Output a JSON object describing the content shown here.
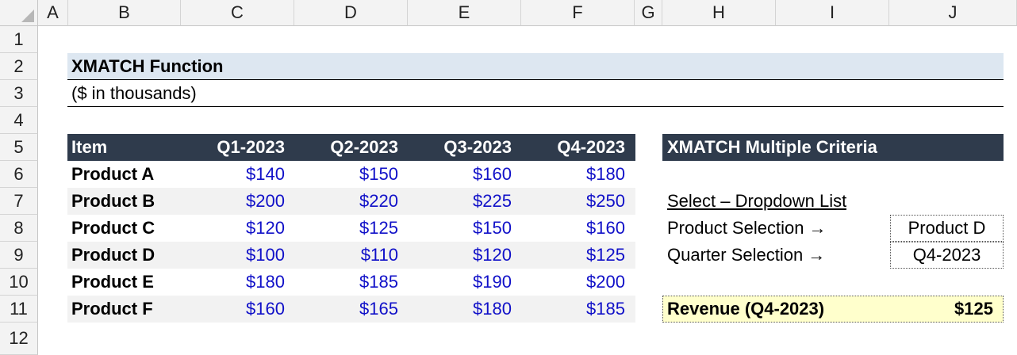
{
  "columns": [
    "A",
    "B",
    "C",
    "D",
    "E",
    "F",
    "G",
    "H",
    "I",
    "J"
  ],
  "rows": [
    "1",
    "2",
    "3",
    "4",
    "5",
    "6",
    "7",
    "8",
    "9",
    "10",
    "11",
    "12"
  ],
  "title": "XMATCH Function",
  "subtitle": "($ in thousands)",
  "table": {
    "headers": [
      "Item",
      "Q1-2023",
      "Q2-2023",
      "Q3-2023",
      "Q4-2023"
    ],
    "rows": [
      {
        "item": "Product A",
        "values": [
          "$140",
          "$150",
          "$160",
          "$180"
        ]
      },
      {
        "item": "Product B",
        "values": [
          "$200",
          "$220",
          "$225",
          "$250"
        ]
      },
      {
        "item": "Product C",
        "values": [
          "$120",
          "$125",
          "$150",
          "$160"
        ]
      },
      {
        "item": "Product D",
        "values": [
          "$100",
          "$110",
          "$120",
          "$125"
        ]
      },
      {
        "item": "Product E",
        "values": [
          "$180",
          "$185",
          "$190",
          "$200"
        ]
      },
      {
        "item": "Product F",
        "values": [
          "$160",
          "$165",
          "$180",
          "$185"
        ]
      }
    ]
  },
  "criteria": {
    "header": "XMATCH Multiple Criteria",
    "select_label": "Select – Dropdown List",
    "product_label": "Product Selection →",
    "product_value": "Product D",
    "quarter_label": "Quarter Selection →",
    "quarter_value": "Q4-2023",
    "result_label": "Revenue (Q4-2023)",
    "result_value": "$125"
  },
  "colors": {
    "header_dark": "#2f3b4c",
    "title_fill": "#dde7f1",
    "band_fill": "#f2f2f2",
    "result_fill": "#ffffcc",
    "value_blue": "#1010c8"
  }
}
